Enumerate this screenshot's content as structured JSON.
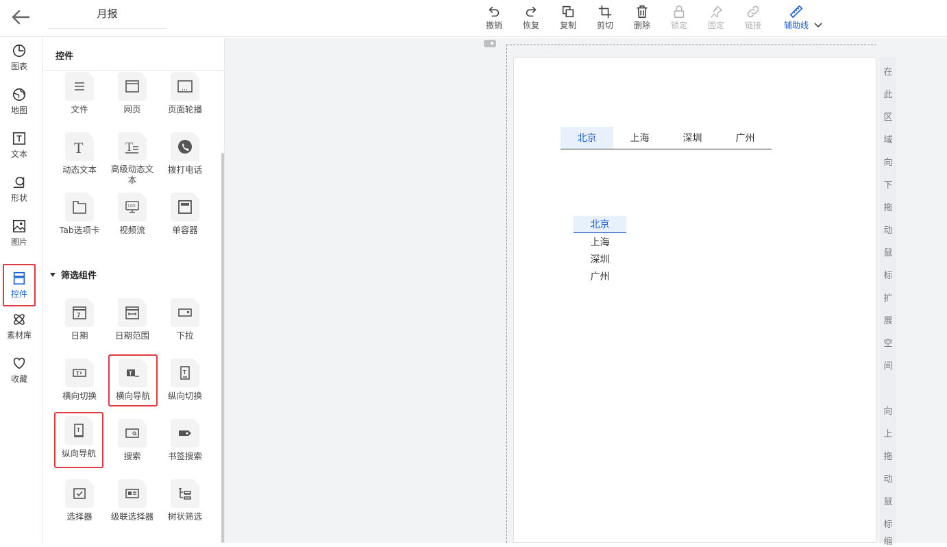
{
  "header": {
    "title": "月报",
    "toolbar": [
      {
        "label": "撤销",
        "icon": "undo-icon"
      },
      {
        "label": "恢复",
        "icon": "redo-icon"
      },
      {
        "label": "复制",
        "icon": "copy-icon"
      },
      {
        "label": "剪切",
        "icon": "crop-icon"
      },
      {
        "label": "删除",
        "icon": "trash-icon"
      },
      {
        "label": "锁定",
        "icon": "lock-icon",
        "disabled": true
      },
      {
        "label": "固定",
        "icon": "pin-icon",
        "disabled": true
      },
      {
        "label": "链接",
        "icon": "link-icon",
        "disabled": true
      },
      {
        "label": "辅助线",
        "icon": "ruler-icon",
        "active": true
      }
    ]
  },
  "rail": {
    "items": [
      {
        "label": "图表",
        "icon": "pie-chart-icon"
      },
      {
        "label": "地图",
        "icon": "globe-icon"
      },
      {
        "label": "文本",
        "icon": "text-icon"
      },
      {
        "label": "形状",
        "icon": "shape-icon"
      },
      {
        "label": "图片",
        "icon": "image-icon"
      },
      {
        "label": "控件",
        "icon": "widget-icon",
        "active": true
      },
      {
        "label": "素材库",
        "icon": "atom-icon"
      },
      {
        "label": "收藏",
        "icon": "heart-icon"
      }
    ]
  },
  "panel": {
    "title": "控件",
    "section_filter": "筛选组件",
    "widgets": [
      {
        "label": "文件",
        "icon": "file-list-icon"
      },
      {
        "label": "网页",
        "icon": "webpage-icon"
      },
      {
        "label": "页面轮播",
        "icon": "carousel-icon"
      },
      {
        "label": "动态文本",
        "icon": "dynamic-text-icon"
      },
      {
        "label": "高级动态文本",
        "icon": "advanced-text-icon"
      },
      {
        "label": "拨打电话",
        "icon": "phone-icon"
      },
      {
        "label": "Tab选项卡",
        "icon": "tab-icon"
      },
      {
        "label": "视频流",
        "icon": "live-icon"
      },
      {
        "label": "单容器",
        "icon": "container-icon"
      }
    ],
    "filters": [
      {
        "label": "日期",
        "icon": "calendar-icon"
      },
      {
        "label": "日期范围",
        "icon": "date-range-icon"
      },
      {
        "label": "下拉",
        "icon": "dropdown-icon"
      },
      {
        "label": "横向切换",
        "icon": "h-switch-icon"
      },
      {
        "label": "横向导航",
        "icon": "h-nav-icon",
        "highlight": true
      },
      {
        "label": "纵向切换",
        "icon": "v-switch-icon"
      },
      {
        "label": "纵向导航",
        "icon": "v-nav-icon",
        "highlight": true
      },
      {
        "label": "搜索",
        "icon": "search-box-icon"
      },
      {
        "label": "书签搜索",
        "icon": "bookmark-search-icon"
      },
      {
        "label": "选择器",
        "icon": "selector-icon"
      },
      {
        "label": "级联选择器",
        "icon": "cascade-icon"
      },
      {
        "label": "树状筛选",
        "icon": "tree-icon"
      }
    ]
  },
  "canvas": {
    "hnav": [
      "北京",
      "上海",
      "深圳",
      "广州"
    ],
    "hnav_selected": 0,
    "vnav": [
      "北京",
      "上海",
      "深圳",
      "广州"
    ],
    "vnav_selected": 0,
    "side_text_top": [
      "在",
      "此",
      "区",
      "域",
      "向",
      "下",
      "拖",
      "动",
      "鼠",
      "标",
      "扩",
      "展",
      "空",
      "间"
    ],
    "side_text_bottom": [
      "向",
      "上",
      "拖",
      "动",
      "鼠",
      "标",
      "缩"
    ]
  },
  "colors": {
    "accent": "#1a5fcf",
    "highlight": "#e0393e",
    "selected_bg": "#e8f0fc"
  }
}
